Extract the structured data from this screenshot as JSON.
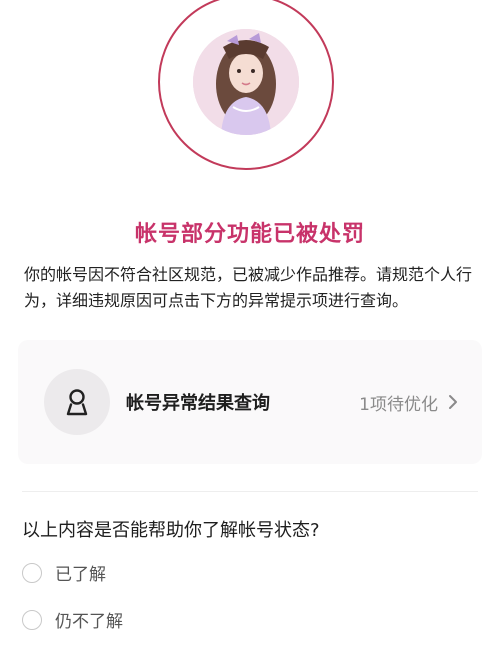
{
  "avatar": {
    "icon": "user-avatar-photo"
  },
  "colors": {
    "accent": "#c8336a",
    "ring": "#c23a5a"
  },
  "notice": {
    "title": "帐号部分功能已被处罚",
    "description": "你的帐号因不符合社区规范，已被减少作品推荐。请规范个人行为，详细违规原因可点击下方的异常提示项进行查询。"
  },
  "card": {
    "icon": "user-outline-icon",
    "label": "帐号异常结果查询",
    "status": "1项待优化"
  },
  "survey": {
    "question": "以上内容是否能帮助你了解帐号状态?",
    "options": [
      {
        "label": "已了解"
      },
      {
        "label": "仍不了解"
      }
    ]
  }
}
